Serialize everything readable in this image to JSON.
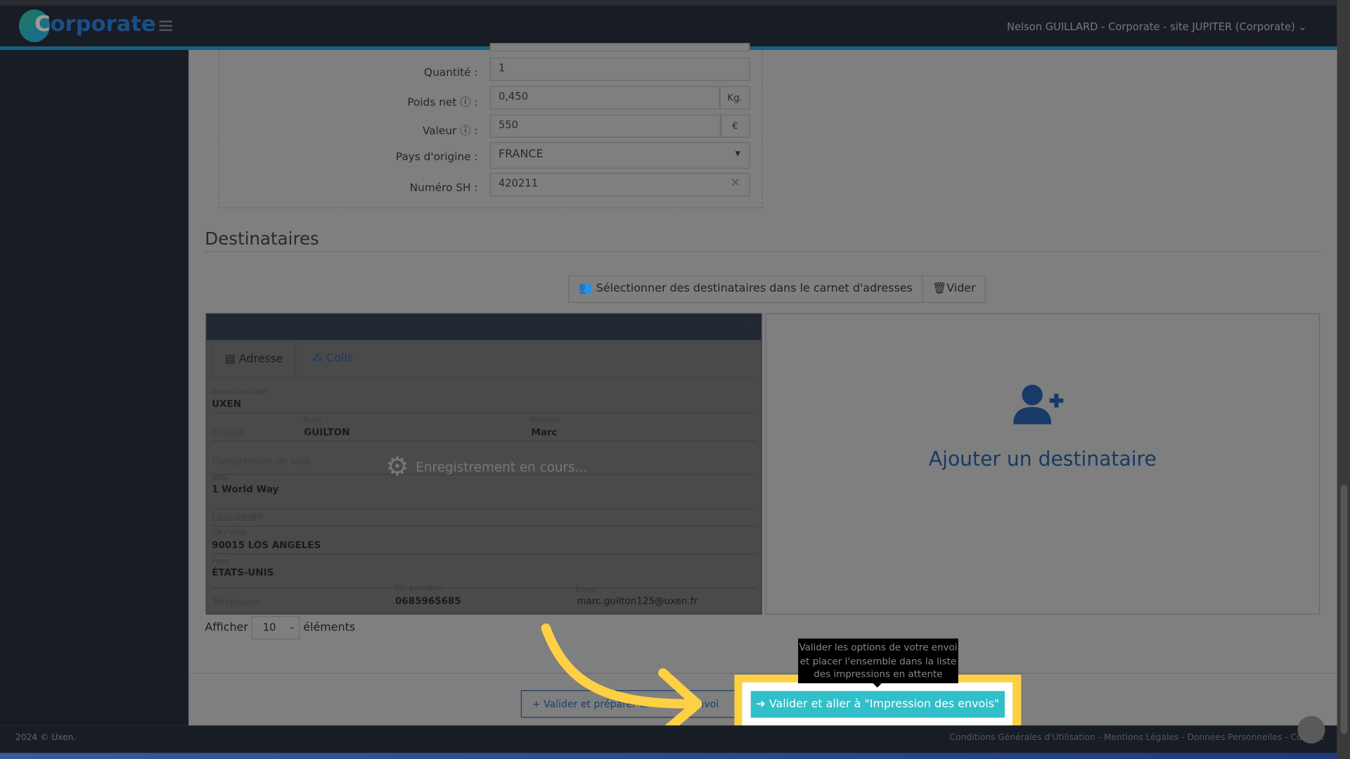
{
  "header": {
    "logo": "Corporate",
    "logo_first_letter": "C",
    "logo_rest": "orporate",
    "user": "Nelson GUILLARD - Corporate - site JUPITER (Corporate)"
  },
  "form": {
    "quantite": {
      "label": "Quantité :",
      "value": "1"
    },
    "poids": {
      "label": "Poids net",
      "colon": ":",
      "value": "0,450",
      "unit": "Kg."
    },
    "valeur": {
      "label": "Valeur",
      "colon": ":",
      "value": "550",
      "unit": "€"
    },
    "pays": {
      "label": "Pays d'origine :",
      "value": "FRANCE"
    },
    "sh": {
      "label": "Numéro SH :",
      "value": "420211"
    }
  },
  "destinataires": {
    "title": "Destinataires",
    "select_button": "Sélectionner des destinataires dans le carnet d'adresses",
    "clear_button": "Vider",
    "card": {
      "tabs": [
        "Adresse",
        "Colis"
      ],
      "raison_sociale_label": "Raison sociale",
      "raison_sociale": "UXEN",
      "civilite_placeholder": "Civilité",
      "nom_label": "Nom",
      "nom": "GUILTON",
      "prenom_label": "Prénom",
      "prenom": "Marc",
      "complement_placeholder": "Complément de voie",
      "voie_label": "Voie",
      "voie": "1 World Way",
      "lieudit_placeholder": "Lieu-dit/BP",
      "cp_label": "CP / Ville",
      "cp": "90015 LOS ANGELES",
      "pays_label": "Pays",
      "pays": "ÉTATS-UNIS",
      "telephone_placeholder": "Téléphone",
      "portable_label": "Tél. portable",
      "portable": "0685965685",
      "email_label": "Email",
      "email": "marc.guilton125@uxen.fr",
      "saving": "Enregistrement en cours..."
    },
    "add_label": "Ajouter un destinataire",
    "show_prefix": "Afficher",
    "show_value": "10",
    "show_suffix": "éléments"
  },
  "actions": {
    "secondary": "Valider et préparer un nouvel envoi",
    "secondary_visible_left": "Valider et prép",
    "secondary_visible_right": "l envoi",
    "primary": "Valider et aller à \"Impression des envois\"",
    "tooltip": "Valider les options de votre envoi et placer l'ensemble dans la liste des impressions en attente"
  },
  "footer": {
    "copyright": "2024 © Uxen.",
    "links": "Conditions Générales d'Utilisation - Mentions Légales - Données Personnelles - Contact"
  },
  "colors": {
    "header": "#181c24",
    "accent_line": "#136180",
    "primary_button": "#31bfca",
    "highlight": "#fed043",
    "brand": "#1a4f86"
  }
}
